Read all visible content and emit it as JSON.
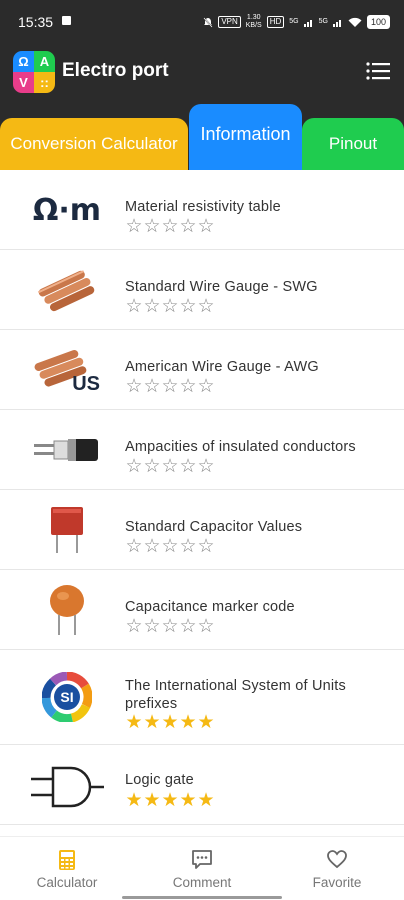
{
  "status": {
    "time": "15:35",
    "vpn": "VPN",
    "speed_top": "1.30",
    "speed_bottom": "KB/S",
    "hd": "HD",
    "net1": "5G",
    "net2": "5G",
    "battery": "100"
  },
  "app": {
    "logo_letters": [
      "Ω",
      "A",
      "V",
      "::"
    ],
    "logo_colors": [
      "#1a8cff",
      "#1fcc4f",
      "#e83d8a",
      "#f5b914"
    ],
    "title": "Electro port",
    "menu_icon": "list-menu-icon"
  },
  "tabs": [
    {
      "label": "Conversion Calculator",
      "color": "#f5b914",
      "selected": false
    },
    {
      "label": "Information",
      "color": "#1a8cff",
      "selected": true
    },
    {
      "label": "Pinout",
      "color": "#1fcc4f",
      "selected": false
    }
  ],
  "items": [
    {
      "label": "Material resistivity table",
      "icon": "ohm-meter-icon",
      "icon_text": "Ω·m",
      "rating": 0
    },
    {
      "label": "Standard Wire Gauge - SWG",
      "icon": "copper-wires-icon",
      "rating": 0
    },
    {
      "label": "American Wire Gauge - AWG",
      "icon": "copper-wires-us-icon",
      "icon_text": "US",
      "rating": 0
    },
    {
      "label": "Ampacities of insulated conductors",
      "icon": "insulated-cable-icon",
      "rating": 0
    },
    {
      "label": "Standard Capacitor Values",
      "icon": "film-capacitor-icon",
      "rating": 0
    },
    {
      "label": "Capacitance marker code",
      "icon": "ceramic-capacitor-icon",
      "rating": 0
    },
    {
      "label": "The International System of Units prefixes",
      "icon": "si-units-icon",
      "icon_text": "SI",
      "rating": 5
    },
    {
      "label": "Logic gate",
      "icon": "and-gate-icon",
      "rating": 5
    }
  ],
  "stars_total": 5,
  "star_colors": {
    "on": "#f5b914",
    "off": "#8a8a8a"
  },
  "bottom_nav": [
    {
      "label": "Calculator",
      "icon": "calculator-icon",
      "active": true
    },
    {
      "label": "Comment",
      "icon": "comment-icon",
      "active": false
    },
    {
      "label": "Favorite",
      "icon": "heart-icon",
      "active": false
    }
  ]
}
